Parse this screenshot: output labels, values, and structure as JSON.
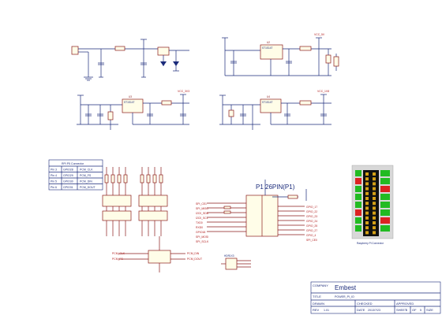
{
  "power_section": {
    "regulators": [
      {
        "ref": "U2",
        "part": "ST1S14T"
      },
      {
        "ref": "U3",
        "part": "ST1S14T"
      },
      {
        "ref": "U4",
        "part": "ST1S14T"
      },
      {
        "ref": "U5",
        "part": "ST1S14T"
      }
    ],
    "nets": {
      "vcc_5v": "VCC_5V",
      "v3_3": "VCC_3V3",
      "v1_8": "VCC_1V8",
      "vbat": "VBAT"
    }
  },
  "rpi_table": {
    "title": "RPI P5 Connector",
    "rows": [
      {
        "pin": "Pin 3",
        "gpio": "GPIO28",
        "func": "PCM_CLK"
      },
      {
        "pin": "Pin 4",
        "gpio": "GPIO29",
        "func": "PCM_FS"
      },
      {
        "pin": "Pin 5",
        "gpio": "GPIO30",
        "func": "PCM_DIN"
      },
      {
        "pin": "Pin 6",
        "gpio": "GPIO31",
        "func": "PCM_DOUT"
      }
    ]
  },
  "header": {
    "label": "P1 26PIN(P1)",
    "left_nets": [
      "SPI_CE1",
      "SPI_MISO",
      "I2C0_SDA",
      "I2C0_SCL",
      "TXD0",
      "RXD0",
      "GPIO18",
      "SPI_MOSI",
      "SPI_SCLK"
    ],
    "right_nets": [
      "GPIO_17",
      "GPIO_22",
      "GPIO_23",
      "GPIO_24",
      "GPIO_25",
      "GPIO_27",
      "GPIO_4",
      "SPI_CE0"
    ]
  },
  "bottom_nets": {
    "left": [
      "PCM_CLK",
      "PCM_FS"
    ],
    "right": [
      "PCM_DIN",
      "PCM_DOUT"
    ],
    "connector": "HDR1X3"
  },
  "connector_image": {
    "caption": "Raspberry Pi Connector",
    "colors": {
      "green": "#22bb22",
      "red": "#dd2222",
      "black": "#111111",
      "gray": "#d8d8d8"
    }
  },
  "title_block": {
    "company_label": "COMPANY",
    "company": "Embest",
    "title_label": "TITLE",
    "title": "POWER_PI_IO",
    "drawn_label": "DRAWN",
    "checked_label": "CHECKED",
    "approved_label": "APPROVED",
    "size_label": "SIZE",
    "code_label": "CODE",
    "drawing_no_label": "DRAWING NO",
    "rev_label": "REV",
    "rev": "1.01",
    "date_label": "DATE",
    "date": "2013/7/23",
    "sheet_label": "SHEET",
    "sheet": "5",
    "of_label": "OF",
    "sheets": "5"
  }
}
